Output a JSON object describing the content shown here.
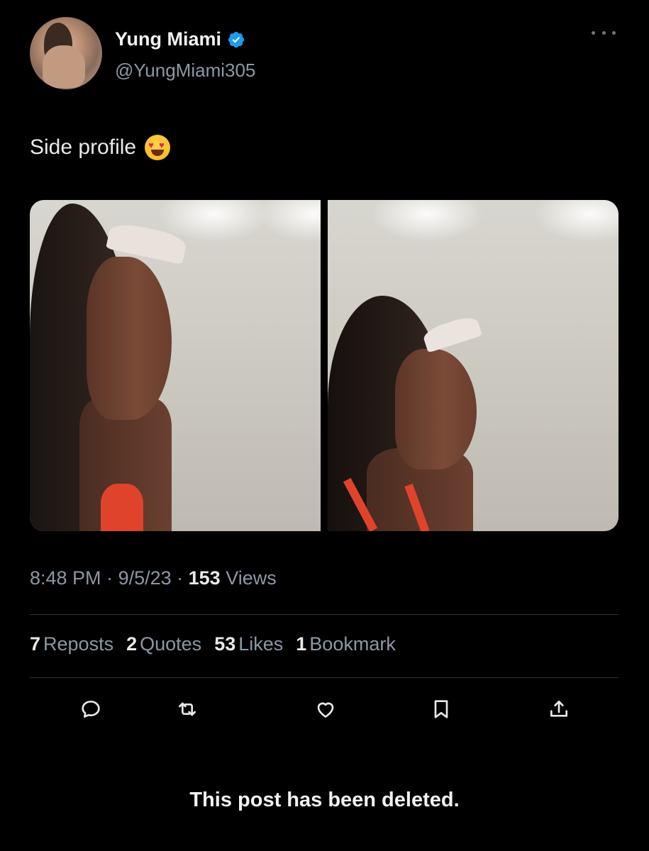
{
  "author": {
    "display_name": "Yung Miami",
    "handle": "@YungMiami305",
    "verified": true
  },
  "tweet": {
    "text": "Side profile",
    "emoji": "smiling-face-with-heart-eyes",
    "images": 2
  },
  "meta": {
    "time": "8:48 PM",
    "sep1": " · ",
    "date": "9/5/23",
    "sep2": " · ",
    "views_count": "153",
    "views_label": " Views"
  },
  "stats": [
    {
      "count": "7",
      "label": "Reposts"
    },
    {
      "count": "2",
      "label": "Quotes"
    },
    {
      "count": "53",
      "label": "Likes"
    },
    {
      "count": "1",
      "label": "Bookmark"
    }
  ],
  "actions": [
    "reply-icon",
    "repost-icon",
    "like-icon",
    "bookmark-icon",
    "share-icon"
  ],
  "footer": {
    "deleted_notice": "This post has been deleted."
  },
  "colors": {
    "background": "#000000",
    "text": "#e7e9ea",
    "secondary": "#8b98a5",
    "verified": "#1d9bf0",
    "divider": "#2f3336"
  }
}
